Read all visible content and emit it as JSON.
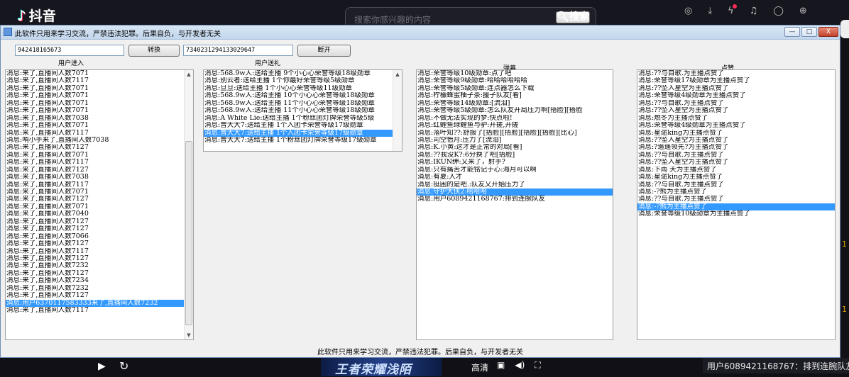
{
  "background": {
    "logo_text": "抖音",
    "search_placeholder": "搜索你感兴趣的内容",
    "search_button": "搜索",
    "side_num": "1",
    "side_num2": "1",
    "banner_text": "王者荣耀浅陌",
    "quality": "高清",
    "ticker": "用户6089421168767：排到连腕队友"
  },
  "window": {
    "title": "此软件只用来学习交流，严禁违法犯罪。后果自负，与开发者无关",
    "buttons": {
      "minimize": "—",
      "maximize": "□",
      "close": "X"
    }
  },
  "controls": {
    "room_id": "942418165673",
    "convert_button": "转换",
    "long_id": "7340231294133029647",
    "disconnect_button": "断开"
  },
  "headers": {
    "enter": "用户进入",
    "gift": "用户送礼",
    "danmu": "弹幕",
    "like": "点赞"
  },
  "lists": {
    "enter": [
      "消息:来了,直播间人数7071",
      "消息:来了,直播间人数7117",
      "消息:来了,直播间人数7071",
      "消息:来了,直播间人数7071",
      "消息:来了,直播间人数7071",
      "消息:来了,直播间人数7071",
      "消息:来了,直播间人数7038",
      "消息:来了,直播间人数7071",
      "消息:来了,直播间人数7117",
      "消息:哨小手来了,直播间人数7038",
      "消息:来了,直播间人数7127",
      "消息:来了,直播间人数7071",
      "消息:来了,直播间人数7117",
      "消息:来了,直播间人数7127",
      "消息:来了,直播间人数7038",
      "消息:来了,直播间人数7117",
      "消息:来了,直播间人数7071",
      "消息:来了,直播间人数7127",
      "消息:来了,直播间人数7071",
      "消息:来了,直播间人数7040",
      "消息:来了,直播间人数7127",
      "消息:来了,直播间人数7127",
      "消息:来了,直播间人数7066",
      "消息:来了,直播间人数7127",
      "消息:来了,直播间人数7117",
      "消息:来了,直播间人数7127",
      "消息:来了,直播间人数7232",
      "消息:来了,直播间人数7127",
      "消息:来了,直播间人数7234",
      "消息:来了,直播间人数7232",
      "消息:来了,直播间人数7127",
      "消息:用户6370117583333来了,直播间人数7232",
      "消息:来了,直播间人数7117"
    ],
    "enter_selected_index": 31,
    "gift": [
      "消息:568.9w人:送给主播 9个小心心荣誉等级18级勋章",
      "消息:别云者:送给主播 1个你最好荣誉等级5级勋章",
      "消息:旦旦:送给主播 1个小心心荣誉等级11级勋章",
      "消息:568.9w人:送给主播 10个小心心荣誉等级18级勋章",
      "消息:568.9w人:送给主播 11个小心心荣誉等级18级勋章",
      "消息:568.9w人:送给主播 11个小心心荣誉等级18级勋章",
      "消息:A White Lie:送给主播 1个粉丝团灯牌荣誉等级5级",
      "消息:曾大大7:送给主播 1个入团卡荣誉等级17级勋章",
      "消息:曾大大7:送给主播 1个入团卡荣誉等级17级勋章",
      "消息:曾大大7:送给主播 1个粉丝团灯牌荣誉等级17级勋章"
    ],
    "gift_selected_index": 8,
    "danmu": [
      "消息:荣誉等级10级勋章:点了吧",
      "消息:荣誉等级9级勋章:哈哈哈哈哈哈",
      "消息:荣誉等级5级勋章:连点器怎么下载",
      "消息:柠檬蜂蜜柚子茶:援子队友[看]",
      "消息:荣誉等级14级勋章:[流泪]",
      "消息:荣誉等级5级勋章:怎么队友开局压力啊[捂脸][捂脸",
      "消息:不做无法实现的梦:快点啦!",
      "消息:红鲤鱼绿鲤鱼与驴:开搓,开搓",
      "消息:落叶知??:舒服了[捂脸][捂脸][捂脸][捂脸][比心]",
      "消息:司空怡月:压力了[流泪]",
      "消息:K.小黄:这才是正常的对局[看]",
      "消息:??我没K?:6分换了吧[捂脸]",
      "消息:IKUN绅:又来了，射手?",
      "消息:只有痛苦才能铭记于心:海月可以啊",
      "消息:有夏:人才",
      "消息:挺困的是吧.:队友又开始压力了",
      "消息:守护大侠2:哈哈哈",
      "消息:用户6089421168767:排到连腕队友"
    ],
    "danmu_selected_index": 16,
    "like": [
      "消息:??与自歌.为主播点赞了",
      "消息:荣誉等级17级勋章为主播点赞了",
      "消息:??坠入星空为主播点赞了",
      "消息:荣誉等级4级勋章为主播点赞了",
      "消息:??与自歌.为主播点赞了",
      "消息:??坠入星空为主播点赞了",
      "消息:燃冬为主播点赞了",
      "消息:荣誉等级4级勋章为主播点赞了",
      "消息:星途king为主播点赞了",
      "消息:??坠入星空为主播点赞了",
      "消息:?遥遥领先?为主播点赞了",
      "消息:??与自歌.为主播点赞了",
      "消息:??坠入星空为主播点赞了",
      "消息:下雨     天为主播点赞了",
      "消息:星途king为主播点赞了",
      "消息:??与自歌.为主播点赞了",
      "消息:-?熊为主播点赞了",
      "消息:??与自歌.为主播点赞了",
      "消息:-?熊为主播点赞了",
      "消息:荣誉等级10级勋章为主播点赞了"
    ],
    "like_selected_index": 18
  },
  "footer": "此软件只用来学习交流，严禁违法犯罪。后果自负，与开发者无关"
}
